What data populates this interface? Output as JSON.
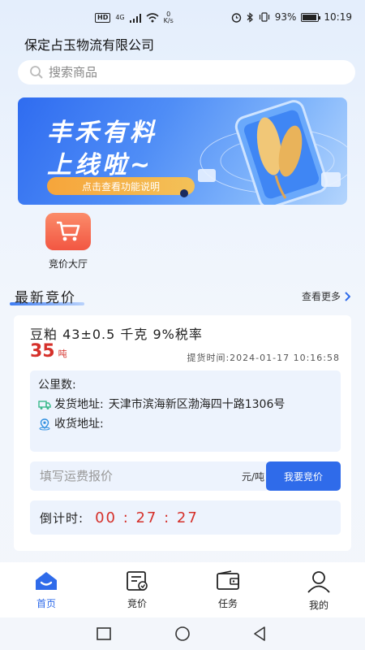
{
  "status": {
    "net_badge": "HD",
    "net_gen": "4G",
    "speed_value": "0",
    "speed_unit": "K/s",
    "battery_pct": "93%",
    "battery_level": 0.93,
    "time": "10:19"
  },
  "header": {
    "company": "保定占玉物流有限公司"
  },
  "search": {
    "placeholder": "搜索商品"
  },
  "banner": {
    "title_line1": "丰禾有料",
    "title_line2": "上线啦~",
    "button": "点击查看功能说明"
  },
  "entries": [
    {
      "label": "竞价大厅",
      "icon": "cart-icon"
    }
  ],
  "section": {
    "title": "最新竞价",
    "more": "查看更多"
  },
  "bid_card": {
    "goods": "豆粕 43±0.5 千克 9%税率",
    "quantity": "35",
    "quantity_unit": "吨",
    "pickup_label": "提货时间:",
    "pickup_time": "2024-01-17 10:16:58",
    "distance_label": "公里数:",
    "distance_value": "",
    "ship_label": "发货地址:",
    "ship_address": "天津市滨海新区渤海四十路1306号",
    "receive_label": "收货地址:",
    "receive_address": "",
    "quote_placeholder": "填写运费报价",
    "quote_unit": "元/吨",
    "bid_button": "我要竞价",
    "countdown_label": "倒计时:",
    "countdown": "00 : 27 : 27"
  },
  "tabs": [
    {
      "label": "首页",
      "icon": "home-icon",
      "active": true
    },
    {
      "label": "竞价",
      "icon": "bid-icon",
      "active": false
    },
    {
      "label": "任务",
      "icon": "wallet-icon",
      "active": false
    },
    {
      "label": "我的",
      "icon": "user-icon",
      "active": false
    }
  ],
  "colors": {
    "accent": "#2f6bea",
    "price_red": "#d5302a",
    "panel_bg": "#edf3fd"
  }
}
